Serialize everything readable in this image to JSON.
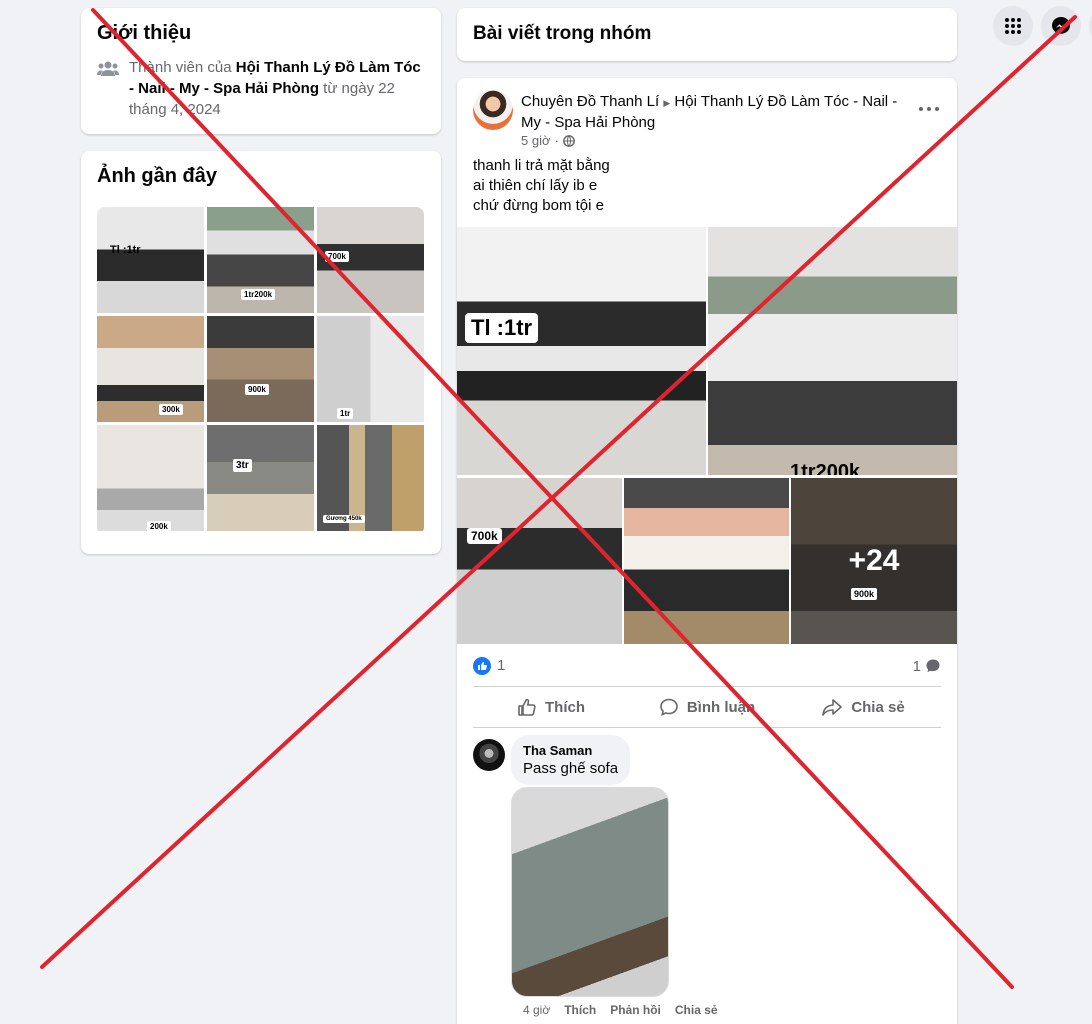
{
  "intro": {
    "title": "Giới thiệu",
    "member_prefix": "Thành viên của ",
    "group_name": "Hội Thanh Lý Đồ Làm Tóc - Nail - My - Spa Hải Phòng",
    "member_suffix": " từ ngày 22 tháng 4, 2024"
  },
  "photos": {
    "title": "Ảnh gần đây",
    "tags": [
      "Tl :1tr",
      "1tr200k",
      "700k",
      "300k",
      "900k",
      "1tr",
      "200k",
      "3tr",
      "Gương 450k"
    ]
  },
  "posts_header": {
    "title": "Bài viết trong nhóm"
  },
  "post": {
    "author": "Chuyên Đồ Thanh Lí",
    "separator": "▶",
    "group": "Hội Thanh Lý Đồ Làm Tóc - Nail - My - Spa Hải Phòng",
    "time": "5 giờ",
    "dot": "·",
    "text_lines": [
      "thanh li trả mặt bằng",
      "ai thiên chí lấy ib e",
      "chứ đừng bom tội e"
    ],
    "media_labels": {
      "img1": "Tl :1tr",
      "img2": "1tr200k",
      "img3": "700k",
      "img5": "900k"
    },
    "more_count": "+24",
    "like_count": "1",
    "comment_count": "1",
    "actions": {
      "like": "Thích",
      "comment": "Bình luận",
      "share": "Chia sẻ"
    }
  },
  "comment": {
    "author": "Tha Saman",
    "text": "Pass ghế sofa",
    "time": "4 giờ",
    "like": "Thích",
    "reply": "Phản hồi",
    "share": "Chia sẻ"
  },
  "colors": {
    "accent": "#1877f2",
    "background": "#f0f2f5",
    "overlay_cross": "#e0242f"
  },
  "icons": [
    "people-icon",
    "globe-icon",
    "more-icon",
    "like-icon",
    "comment-icon",
    "share-icon",
    "apps-grid-icon",
    "messenger-icon"
  ]
}
